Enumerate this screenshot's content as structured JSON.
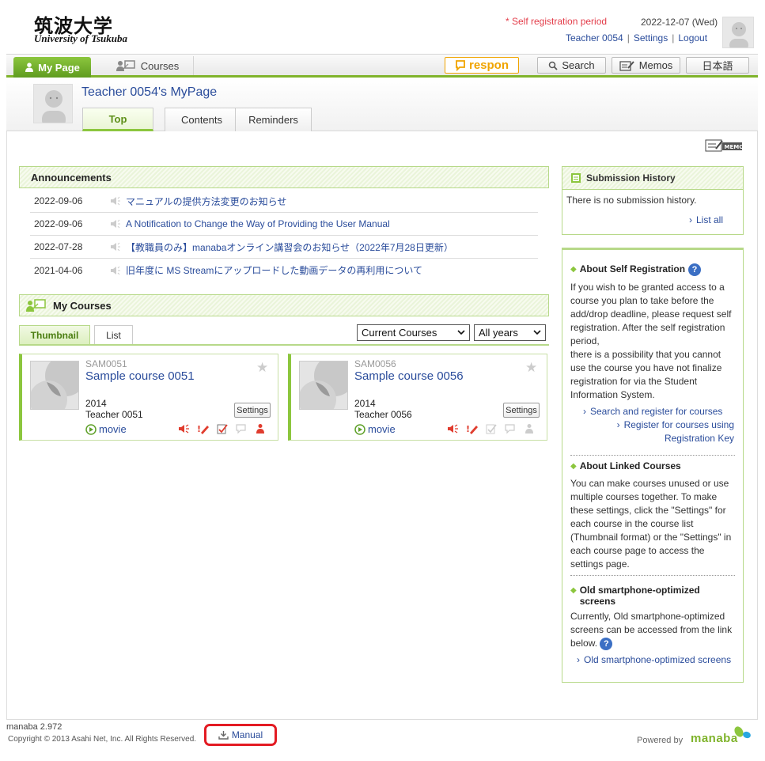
{
  "header": {
    "logo_jp": "筑波大学",
    "logo_en": "University of Tsukuba",
    "self_registration": "* Self registration period",
    "date": "2022-12-07 (Wed)",
    "user_link": "Teacher 0054",
    "settings_link": "Settings",
    "logout_link": "Logout",
    "separator": "|"
  },
  "nav": {
    "mypage_label": "My Page",
    "courses_label": "Courses",
    "respon_label": "respon",
    "search_label": "Search",
    "memos_label": "Memos",
    "language_label": "日本語"
  },
  "profile": {
    "title": "Teacher 0054's MyPage",
    "tabs": [
      {
        "label": "Top",
        "active": true
      },
      {
        "label": "Contents",
        "active": false
      },
      {
        "label": "Reminders",
        "active": false
      }
    ]
  },
  "announcements": {
    "title": "Announcements",
    "items": [
      {
        "date": "2022-09-06",
        "text": "マニュアルの提供方法変更のお知らせ"
      },
      {
        "date": "2022-09-06",
        "text": "A Notification to Change the Way of Providing the User Manual"
      },
      {
        "date": "2022-07-28",
        "text": "【教職員のみ】manabaオンライン講習会のお知らせ（2022年7月28日更新）"
      },
      {
        "date": "2021-04-06",
        "text": "旧年度に MS Streamにアップロードした動画データの再利用について"
      }
    ]
  },
  "my_courses": {
    "title": "My Courses",
    "tab_thumbnail": "Thumbnail",
    "tab_list": "List",
    "filter_selected": "Current Courses",
    "year_selected": "All years",
    "settings_label": "Settings",
    "movie_label": "movie",
    "courses": [
      {
        "code": "SAM0051",
        "name": "Sample course 0051",
        "year": "2014",
        "teacher": "Teacher 0051"
      },
      {
        "code": "SAM0056",
        "name": "Sample course 0056",
        "year": "2014",
        "teacher": "Teacher 0056"
      }
    ]
  },
  "memo_label": "MEMO",
  "submission": {
    "title": "Submission History",
    "empty": "There is no submission history.",
    "list_all": "List all"
  },
  "info": {
    "self_reg_title": "About Self Registration",
    "self_reg_text_1": "If you wish to be granted access to a course you plan to take before the add/drop deadline, please request self registration. After the self registration period,",
    "self_reg_text_2": "there is a possibility that you cannot use the course you have not finalize registration for via the Student Information System.",
    "search_register": "Search and register for courses",
    "register_key_1": "Register for courses using",
    "register_key_2": "Registration Key",
    "linked_title": "About Linked Courses",
    "linked_text": "You can make courses unused or use multiple courses together. To make these settings, click the \"Settings\" for each course in the course list (Thumbnail format) or the \"Settings\" in each course page to access the settings page.",
    "smartphone_title": "Old smartphone-optimized screens",
    "smartphone_text": "Currently, Old smartphone-optimized screens can be accessed from the link below.",
    "smartphone_link": "Old smartphone-optimized screens",
    "help_glyph": "?"
  },
  "footer": {
    "version": "manaba 2.972",
    "copyright": "Copyright © 2013 Asahi Net, Inc. All Rights Reserved.",
    "manual": "Manual",
    "powered_by": "Powered by",
    "powered_logo": "manaba"
  },
  "colors": {
    "accent_green": "#8cc63e",
    "link_blue": "#2a4c9b",
    "alert_red": "#e33d4a",
    "respon_orange": "#f0a400",
    "highlight_red": "#e31b23"
  }
}
